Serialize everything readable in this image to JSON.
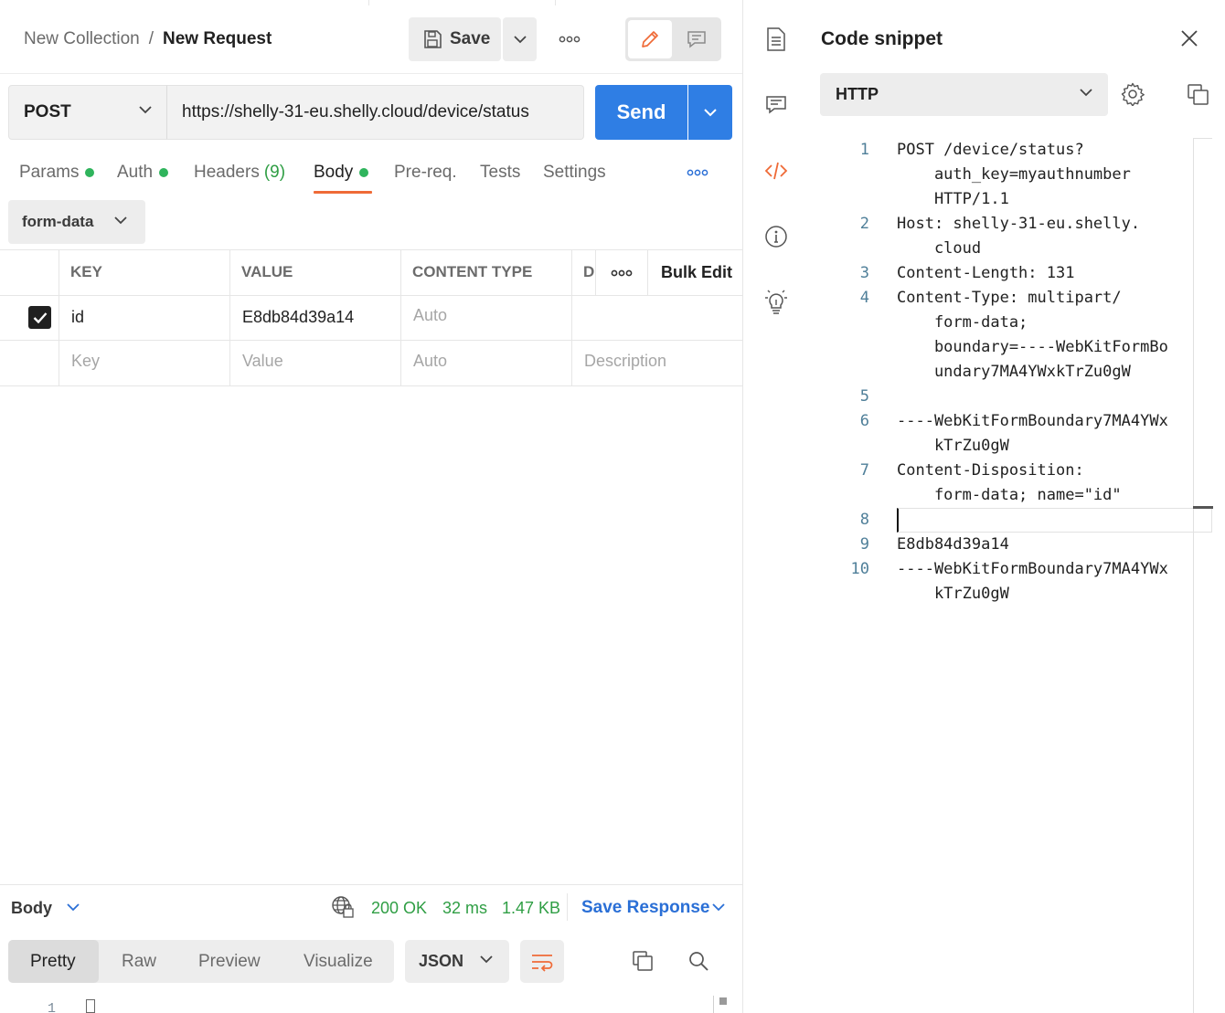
{
  "header": {
    "breadcrumb_parent": "New Collection",
    "breadcrumb_separator": "/",
    "breadcrumb_current": "New Request",
    "save_label": "Save"
  },
  "request": {
    "method": "POST",
    "url": "https://shelly-31-eu.shelly.cloud/device/status",
    "send_label": "Send"
  },
  "tabs": {
    "params": "Params",
    "auth": "Auth",
    "headers": "Headers",
    "headers_count": "(9)",
    "body": "Body",
    "prereq": "Pre-req.",
    "tests": "Tests",
    "settings": "Settings"
  },
  "body_mode": "form-data",
  "table": {
    "col_key": "KEY",
    "col_value": "VALUE",
    "col_content_type": "CONTENT TYPE",
    "col_description_short": "D",
    "bulk_edit": "Bulk Edit",
    "rows": [
      {
        "key": "id",
        "value": "E8db84d39a14",
        "content_type": "Auto",
        "checked": true
      }
    ],
    "placeholder": {
      "key": "Key",
      "value": "Value",
      "content_type": "Auto",
      "description": "Description"
    }
  },
  "response": {
    "section_label": "Body",
    "status": "200 OK",
    "time": "32 ms",
    "size": "1.47 KB",
    "save_response": "Save Response",
    "views": [
      "Pretty",
      "Raw",
      "Preview",
      "Visualize"
    ],
    "active_view": "Pretty",
    "format": "JSON",
    "first_line_number": "1"
  },
  "code_snippet": {
    "title": "Code snippet",
    "language": "HTTP",
    "lines": [
      {
        "n": "1",
        "text": "POST /device/status?"
      },
      {
        "n": "",
        "text": "    auth_key=myauthnumber"
      },
      {
        "n": "",
        "text": "    HTTP/1.1"
      },
      {
        "n": "2",
        "text": "Host: shelly-31-eu.shelly."
      },
      {
        "n": "",
        "text": "    cloud"
      },
      {
        "n": "3",
        "text": "Content-Length: 131"
      },
      {
        "n": "4",
        "text": "Content-Type: multipart/"
      },
      {
        "n": "",
        "text": "    form-data;"
      },
      {
        "n": "",
        "text": "    boundary=----WebKitFormBo"
      },
      {
        "n": "",
        "text": "    undary7MA4YWxkTrZu0gW"
      },
      {
        "n": "5",
        "text": ""
      },
      {
        "n": "6",
        "text": "----WebKitFormBoundary7MA4YWx"
      },
      {
        "n": "",
        "text": "    kTrZu0gW"
      },
      {
        "n": "7",
        "text": "Content-Disposition:"
      },
      {
        "n": "",
        "text": "    form-data; name=\"id\""
      },
      {
        "n": "8",
        "text": ""
      },
      {
        "n": "9",
        "text": "E8db84d39a14"
      },
      {
        "n": "10",
        "text": "----WebKitFormBoundary7MA4YWx"
      },
      {
        "n": "",
        "text": "    kTrZu0gW"
      }
    ]
  },
  "colors": {
    "accent": "#ef6a37",
    "send_blue": "#2f7ee4",
    "status_green": "#2f9e44",
    "link_blue": "#2a6fd6"
  }
}
